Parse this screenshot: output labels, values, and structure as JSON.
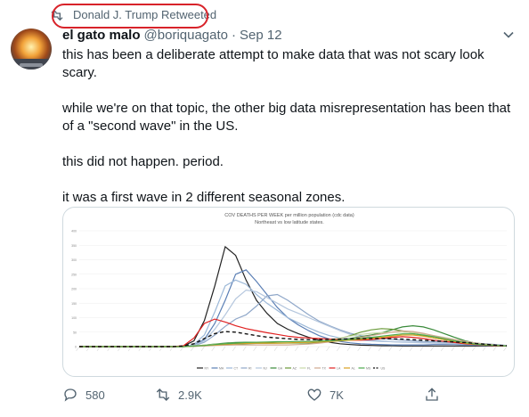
{
  "retweet": {
    "label": "Donald J. Trump Retweeted",
    "icon": "retweet-icon",
    "highlight_color": "#d8232a"
  },
  "tweet": {
    "display_name": "el gato malo",
    "handle": "@boriquagato",
    "separator": "·",
    "date": "Sep 12",
    "paragraphs": [
      "this has been a deliberate attempt to make data that was not scary look scary.",
      "while we're on that topic, the other big data misrepresentation has been that of a \"second wave\" in the US.",
      "this did not happen.  period.",
      "it was a first wave in 2 different seasonal zones."
    ]
  },
  "actions": {
    "reply_count": "580",
    "retweet_count": "2.9K",
    "like_count": "7K"
  },
  "chart_data": {
    "type": "line",
    "title": "COV DEATHS PER WEEK per million population (cdc data)",
    "subtitle": "Northeast vs low latitude states.",
    "ylim": [
      0,
      400
    ],
    "y_ticks": [
      "400",
      "350",
      "300",
      "250",
      "200",
      "150",
      "100",
      "50",
      "0"
    ],
    "x": [
      0,
      1,
      2,
      3,
      4,
      5,
      6,
      7,
      8,
      9,
      10,
      11,
      12,
      13,
      14,
      15,
      16,
      17,
      18,
      19,
      20,
      21,
      22,
      23,
      24,
      25,
      26,
      27,
      28,
      29,
      30,
      31,
      32,
      33,
      34,
      35,
      36,
      37,
      38,
      39,
      40,
      41
    ],
    "series": [
      {
        "name": "NY",
        "color": "#222222",
        "dash": "",
        "values": [
          0,
          0,
          0,
          0,
          0,
          0,
          0,
          0,
          0,
          0,
          2,
          20,
          90,
          210,
          345,
          315,
          230,
          160,
          115,
          80,
          60,
          45,
          32,
          22,
          15,
          10,
          7,
          5,
          4,
          3,
          3,
          2,
          2,
          2,
          2,
          2,
          2,
          2,
          2,
          2,
          2,
          2
        ]
      },
      {
        "name": "MA",
        "color": "#5b7fb5",
        "dash": "",
        "values": [
          0,
          0,
          0,
          0,
          0,
          0,
          0,
          0,
          0,
          0,
          0,
          5,
          25,
          80,
          160,
          250,
          265,
          225,
          180,
          135,
          100,
          75,
          55,
          38,
          26,
          18,
          13,
          10,
          8,
          7,
          6,
          6,
          6,
          6,
          7,
          7,
          7,
          6,
          5,
          4,
          3,
          2
        ]
      },
      {
        "name": "CT",
        "color": "#9cb8d8",
        "dash": "",
        "values": [
          0,
          0,
          0,
          0,
          0,
          0,
          0,
          0,
          0,
          0,
          0,
          8,
          40,
          120,
          210,
          230,
          215,
          180,
          150,
          125,
          100,
          82,
          65,
          50,
          38,
          30,
          25,
          22,
          20,
          18,
          17,
          16,
          15,
          14,
          13,
          12,
          11,
          10,
          9,
          7,
          5,
          3
        ]
      },
      {
        "name": "RI",
        "color": "#8fa7c9",
        "dash": "",
        "values": [
          0,
          0,
          0,
          0,
          0,
          0,
          0,
          0,
          0,
          0,
          0,
          3,
          15,
          40,
          70,
          95,
          110,
          140,
          175,
          180,
          160,
          135,
          110,
          88,
          72,
          58,
          46,
          38,
          32,
          28,
          25,
          22,
          20,
          18,
          17,
          16,
          15,
          14,
          12,
          10,
          7,
          4
        ]
      },
      {
        "name": "NJ",
        "color": "#b4c6dd",
        "dash": "",
        "values": [
          0,
          0,
          0,
          0,
          0,
          0,
          0,
          0,
          0,
          0,
          0,
          4,
          20,
          60,
          110,
          165,
          195,
          190,
          170,
          150,
          130,
          115,
          100,
          85,
          70,
          55,
          42,
          32,
          25,
          20,
          17,
          15,
          14,
          13,
          12,
          11,
          10,
          9,
          8,
          6,
          4,
          2
        ]
      },
      {
        "name": "GA",
        "color": "#3a8a3a",
        "dash": "",
        "values": [
          0,
          0,
          0,
          0,
          0,
          0,
          0,
          0,
          0,
          0,
          0,
          2,
          5,
          9,
          12,
          14,
          15,
          15,
          14,
          13,
          12,
          11,
          12,
          14,
          18,
          22,
          28,
          34,
          40,
          48,
          58,
          68,
          72,
          68,
          58,
          45,
          32,
          20,
          12,
          8,
          5,
          2
        ]
      },
      {
        "name": "AZ",
        "color": "#6a9a3a",
        "dash": "",
        "values": [
          0,
          0,
          0,
          0,
          0,
          0,
          0,
          0,
          0,
          0,
          0,
          1,
          3,
          5,
          7,
          9,
          10,
          11,
          11,
          11,
          11,
          12,
          13,
          15,
          20,
          28,
          38,
          50,
          58,
          62,
          60,
          54,
          46,
          38,
          30,
          24,
          18,
          13,
          9,
          6,
          4,
          2
        ]
      },
      {
        "name": "FL",
        "color": "#c8d8a8",
        "dash": "",
        "values": [
          0,
          0,
          0,
          0,
          0,
          0,
          0,
          0,
          0,
          0,
          0,
          2,
          5,
          8,
          10,
          12,
          12,
          12,
          12,
          11,
          11,
          12,
          14,
          18,
          24,
          30,
          36,
          42,
          46,
          48,
          50,
          50,
          48,
          44,
          38,
          32,
          25,
          18,
          12,
          8,
          5,
          2
        ]
      },
      {
        "name": "TX",
        "color": "#d0a890",
        "dash": "",
        "values": [
          0,
          0,
          0,
          0,
          0,
          0,
          0,
          0,
          0,
          0,
          0,
          1,
          2,
          4,
          5,
          6,
          6,
          6,
          6,
          6,
          6,
          7,
          9,
          12,
          16,
          21,
          26,
          32,
          38,
          44,
          50,
          54,
          52,
          46,
          38,
          30,
          24,
          18,
          12,
          8,
          5,
          2
        ]
      },
      {
        "name": "LA",
        "color": "#e02020",
        "dash": "",
        "values": [
          0,
          0,
          0,
          0,
          0,
          0,
          0,
          0,
          0,
          0,
          3,
          30,
          80,
          95,
          85,
          72,
          62,
          55,
          48,
          42,
          36,
          32,
          30,
          28,
          26,
          24,
          22,
          22,
          24,
          28,
          32,
          34,
          32,
          28,
          22,
          18,
          14,
          10,
          7,
          5,
          3,
          2
        ]
      },
      {
        "name": "AL",
        "color": "#d8a020",
        "dash": "",
        "values": [
          0,
          0,
          0,
          0,
          0,
          0,
          0,
          0,
          0,
          0,
          0,
          2,
          4,
          6,
          8,
          10,
          11,
          12,
          12,
          12,
          13,
          14,
          15,
          16,
          18,
          20,
          22,
          25,
          28,
          32,
          36,
          40,
          40,
          36,
          30,
          24,
          18,
          12,
          8,
          6,
          4,
          2
        ]
      },
      {
        "name": "MS",
        "color": "#4ca84c",
        "dash": "",
        "values": [
          0,
          0,
          0,
          0,
          0,
          0,
          0,
          0,
          0,
          0,
          0,
          2,
          4,
          7,
          10,
          12,
          14,
          15,
          16,
          17,
          17,
          18,
          18,
          19,
          20,
          22,
          25,
          28,
          32,
          36,
          40,
          44,
          44,
          40,
          34,
          27,
          20,
          14,
          9,
          6,
          4,
          2
        ]
      },
      {
        "name": "US",
        "color": "#111111",
        "dash": "4,3",
        "values": [
          0,
          0,
          0,
          0,
          0,
          0,
          0,
          0,
          0,
          0,
          2,
          10,
          28,
          45,
          52,
          50,
          44,
          38,
          33,
          30,
          27,
          25,
          24,
          24,
          25,
          26,
          27,
          28,
          28,
          28,
          27,
          26,
          24,
          22,
          20,
          18,
          16,
          14,
          11,
          8,
          5,
          3
        ]
      }
    ]
  }
}
